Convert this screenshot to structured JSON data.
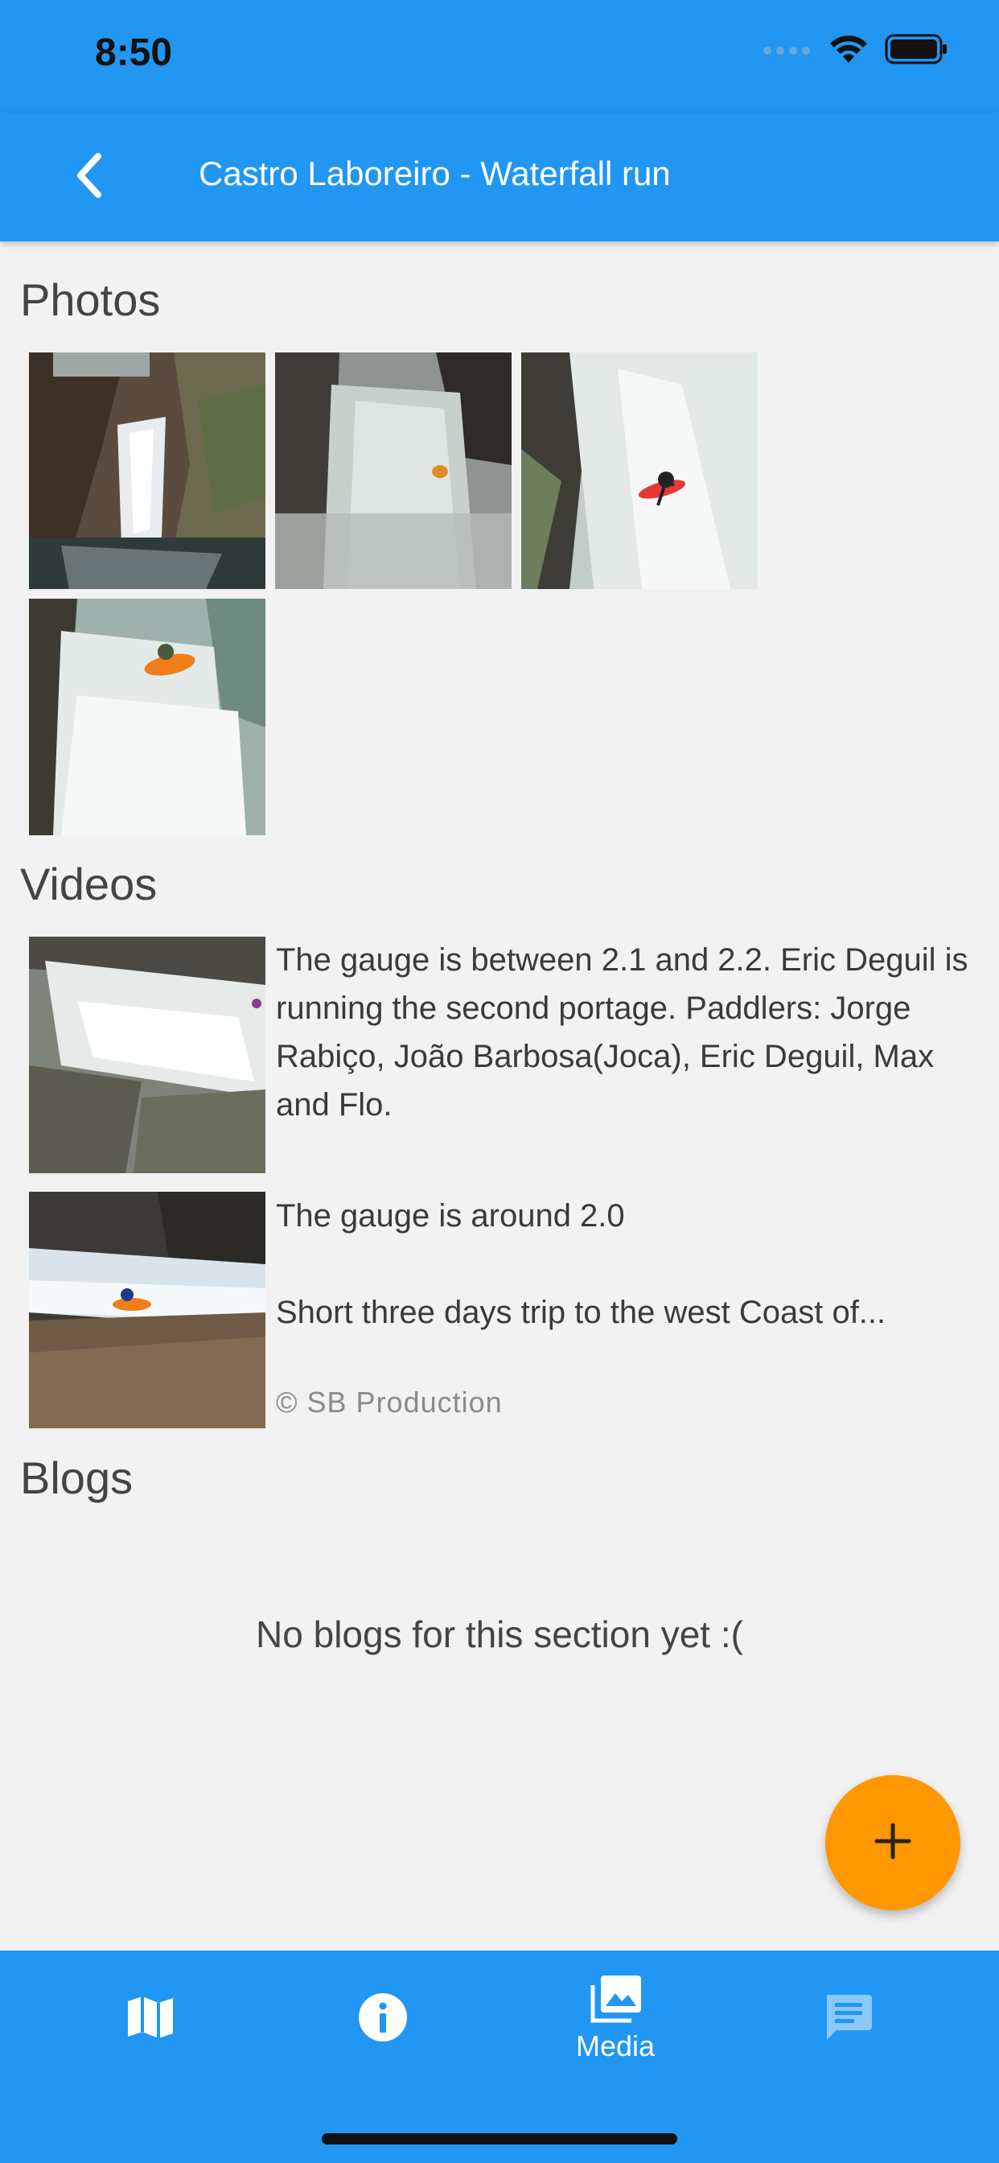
{
  "status_bar": {
    "time": "8:50"
  },
  "app_bar": {
    "title": "Castro Laboreiro - Waterfall run"
  },
  "photos": {
    "heading": "Photos"
  },
  "videos": {
    "heading": "Videos",
    "items": [
      {
        "description": "The gauge is between 2.1 and 2.2. Eric Deguil is running the second portage. Paddlers: Jorge Rabiço, João Barbosa(Joca), Eric Deguil, Max and Flo."
      },
      {
        "line1": "The gauge is around 2.0",
        "line2": "Short three days trip to the west Coast of...",
        "credit": "© SB Production"
      }
    ]
  },
  "blogs": {
    "heading": "Blogs",
    "empty_text": "No blogs for this section yet :("
  },
  "fab": {
    "icon": "plus-icon",
    "color": "#ff9800"
  },
  "bottom_nav": {
    "items": [
      {
        "icon": "map-icon"
      },
      {
        "icon": "info-icon"
      },
      {
        "icon": "image-icon",
        "label": "Media",
        "active": true
      },
      {
        "icon": "chat-icon"
      }
    ]
  },
  "colors": {
    "primary": "#2196f3",
    "accent": "#ff9800",
    "background": "#f2f2f2"
  }
}
